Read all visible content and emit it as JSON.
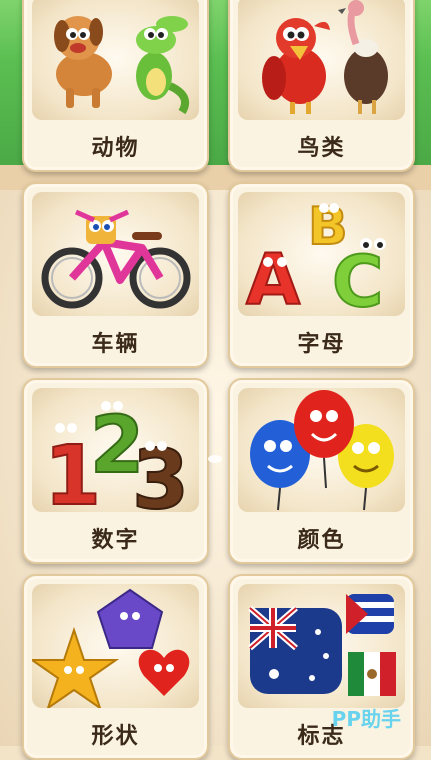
{
  "categories": [
    {
      "label": "动物",
      "icon": "animals-dog-crocodile-icon"
    },
    {
      "label": "鸟类",
      "icon": "birds-parrot-vulture-icon"
    },
    {
      "label": "车辆",
      "icon": "vehicle-bicycle-icon"
    },
    {
      "label": "字母",
      "icon": "letters-abc-icon"
    },
    {
      "label": "数字",
      "icon": "numbers-123-icon"
    },
    {
      "label": "颜色",
      "icon": "colors-balloons-icon"
    },
    {
      "label": "形状",
      "icon": "shapes-star-pentagon-heart-icon"
    },
    {
      "label": "标志",
      "icon": "flags-icon"
    }
  ],
  "watermark": "PP助手"
}
